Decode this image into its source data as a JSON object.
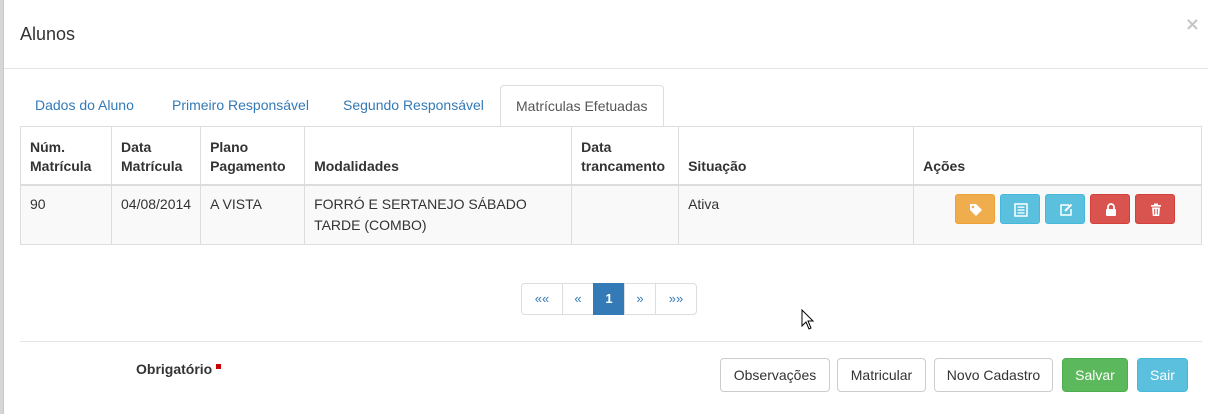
{
  "modal": {
    "title": "Alunos",
    "close_glyph": "×"
  },
  "tabs": [
    {
      "label": "Dados do Aluno"
    },
    {
      "label": "Primeiro Responsável"
    },
    {
      "label": "Segundo Responsável"
    },
    {
      "label": "Matrículas Efetuadas",
      "active": true
    }
  ],
  "table": {
    "headers": {
      "num_line1": "Núm.",
      "num_line2": "Matrícula",
      "data_line1": "Data",
      "data_line2": "Matrícula",
      "plano_line1": "Plano",
      "plano_line2": "Pagamento",
      "modalidades": "Modalidades",
      "trancamento_line1": "Data",
      "trancamento_line2": "trancamento",
      "situacao": "Situação",
      "acoes": "Ações"
    },
    "rows": [
      {
        "num": "90",
        "data": "04/08/2014",
        "plano": "A VISTA",
        "modalidades": "FORRÓ E SERTANEJO SÁBADO TARDE (COMBO)",
        "trancamento": "",
        "situacao": "Ativa"
      }
    ],
    "action_icons": [
      "tag-icon",
      "list-icon",
      "edit-icon",
      "lock-icon",
      "trash-icon"
    ]
  },
  "pagination": {
    "first": "««",
    "prev": "«",
    "current": "1",
    "next": "»",
    "last": "»»"
  },
  "footer": {
    "required_label": "Obrigatório",
    "buttons": {
      "observacoes": "Observações",
      "matricular": "Matricular",
      "novo_cadastro": "Novo Cadastro",
      "salvar": "Salvar",
      "sair": "Sair"
    }
  },
  "colors": {
    "primary": "#337ab7",
    "warning": "#f0ad4e",
    "info": "#5bc0de",
    "danger": "#d9534f",
    "success": "#5cb85c"
  }
}
